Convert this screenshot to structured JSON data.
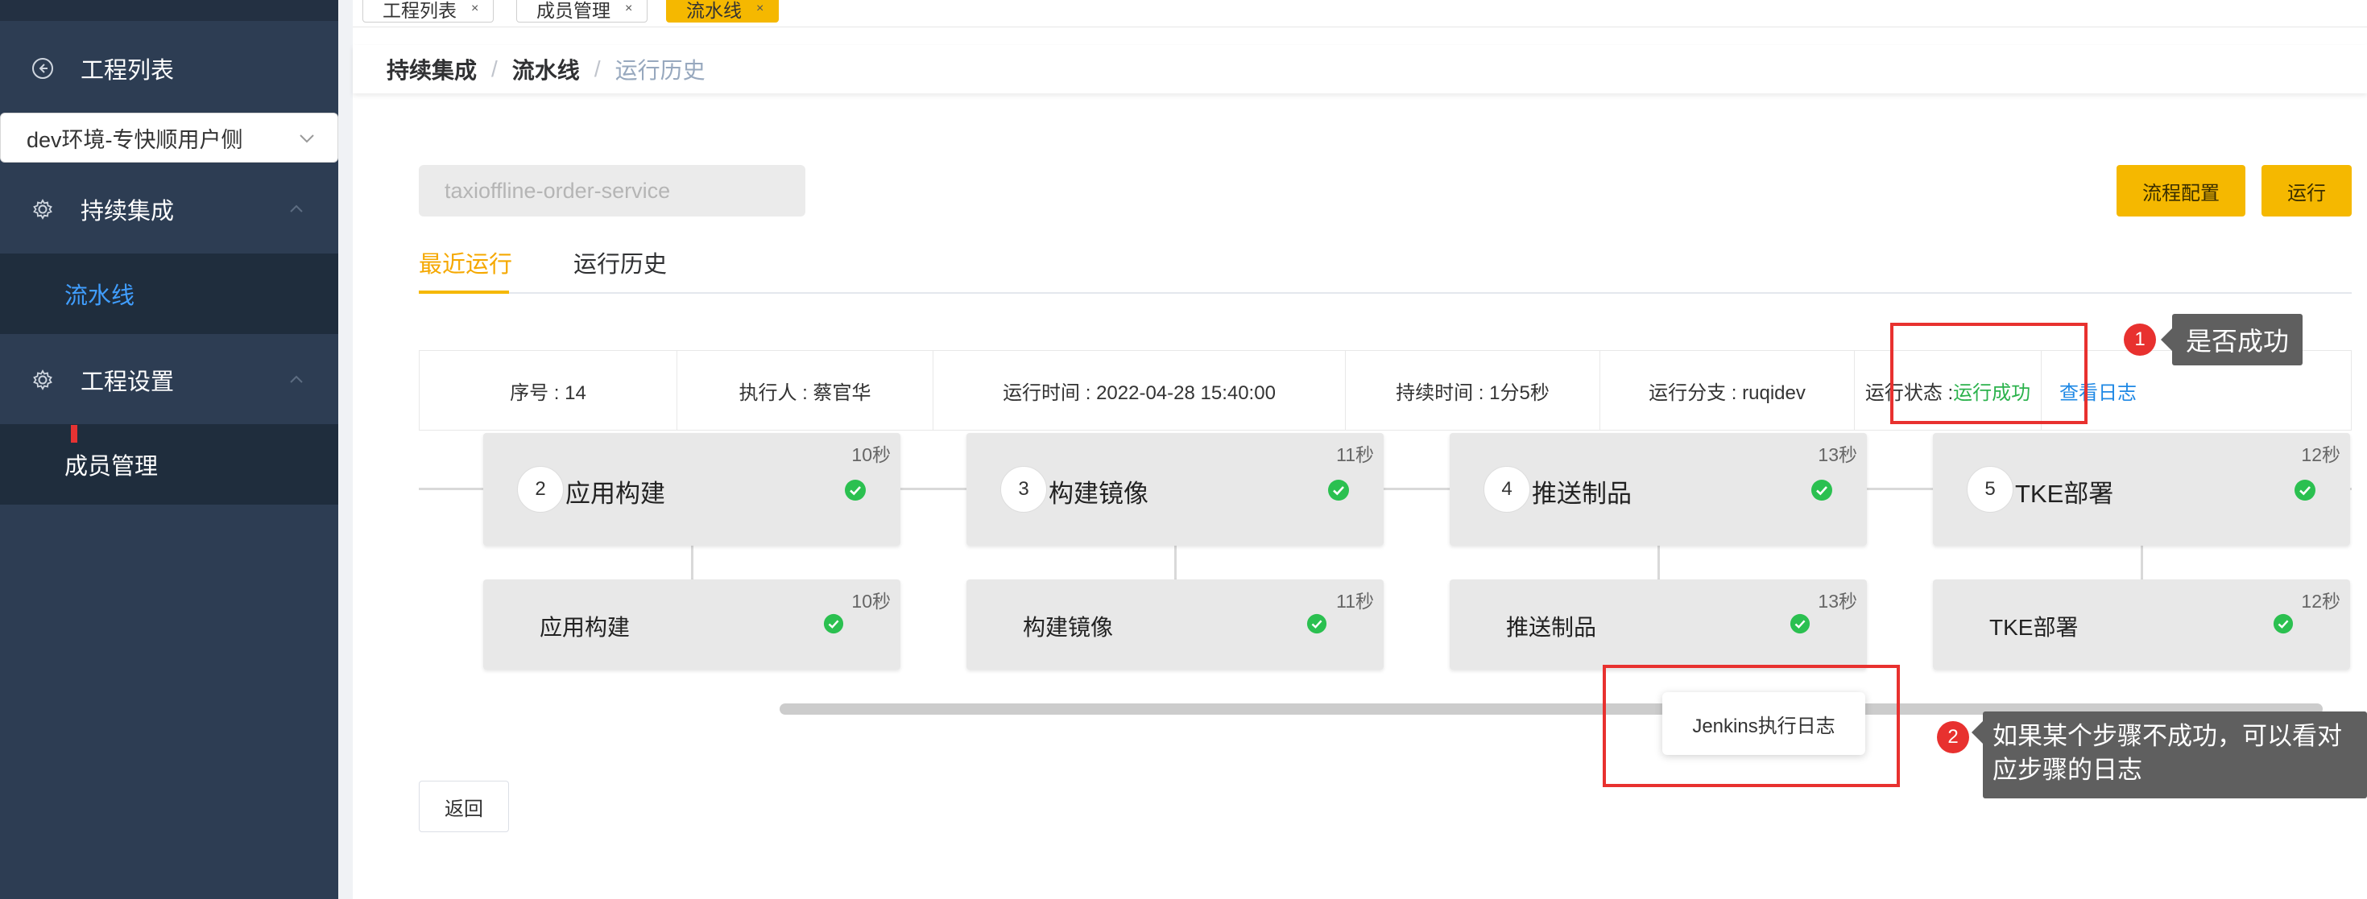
{
  "tabs": [
    {
      "label": "工程列表",
      "close": "×"
    },
    {
      "label": "成员管理",
      "close": "×"
    },
    {
      "label": "流水线",
      "close": "×"
    }
  ],
  "sidebar": {
    "project_list": "工程列表",
    "env_select": "dev环境-专快顺用户侧",
    "ci": "持续集成",
    "pipeline": "流水线",
    "project_settings": "工程设置",
    "members": "成员管理"
  },
  "breadcrumb": [
    "持续集成",
    "流水线",
    "运行历史"
  ],
  "breadcrumb_sep": "/",
  "project_name": "taxioffline-order-service",
  "buttons": {
    "config": "流程配置",
    "run": "运行",
    "back": "返回"
  },
  "run_tabs": [
    "最近运行",
    "运行历史"
  ],
  "run_info": {
    "seq": "序号 : 14",
    "executor": "执行人 : 蔡官华",
    "time": "运行时间 : 2022-04-28 15:40:00",
    "duration": "持续时间 : 1分5秒",
    "branch": "运行分支 : ruqidev",
    "status_label": "运行状态 : ",
    "status_value": "运行成功",
    "view_log": "查看日志"
  },
  "stages": [
    {
      "num": "2",
      "name": "应用构建",
      "dur": "10秒",
      "step": "应用构建",
      "step_dur": "10秒"
    },
    {
      "num": "3",
      "name": "构建镜像",
      "dur": "11秒",
      "step": "构建镜像",
      "step_dur": "11秒"
    },
    {
      "num": "4",
      "name": "推送制品",
      "dur": "13秒",
      "step": "推送制品",
      "step_dur": "13秒"
    },
    {
      "num": "5",
      "name": "TKE部署",
      "dur": "12秒",
      "step": "TKE部署",
      "step_dur": "12秒"
    }
  ],
  "tooltip": "Jenkins执行日志",
  "annotations": [
    {
      "num": "1",
      "text": "是否成功"
    },
    {
      "num": "2",
      "line1": "如果某个步骤不成功，可以看对",
      "line2": "应步骤的日志"
    }
  ],
  "colors": {
    "sidebar": "#2d3d53",
    "accent": "#f5b800",
    "success": "#2bb24c",
    "link": "#1e88e5",
    "annotation_red": "#e8312f"
  }
}
